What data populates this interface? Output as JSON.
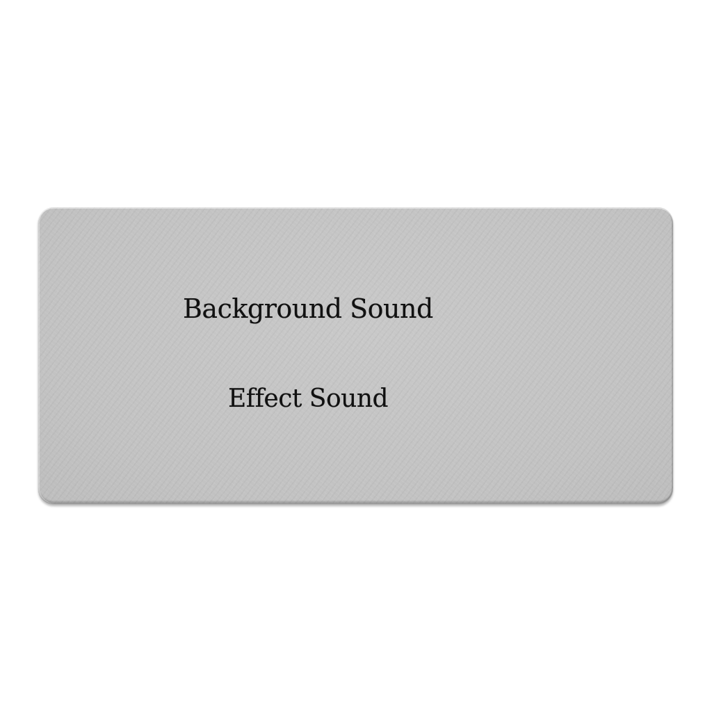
{
  "menu": {
    "options": [
      {
        "label": "Background Sound"
      },
      {
        "label": "Effect Sound"
      }
    ]
  },
  "colors": {
    "page_background": "#ffffff",
    "panel": "#c4c4c4",
    "text": "#111111"
  }
}
